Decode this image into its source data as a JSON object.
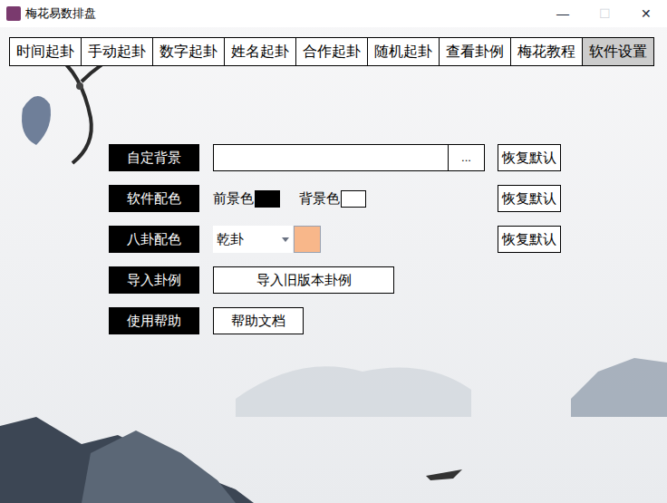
{
  "window": {
    "title": "梅花易数排盘",
    "controls": [
      "—",
      "☐",
      "✕"
    ]
  },
  "tabs": [
    {
      "label": "时间起卦",
      "selected": false
    },
    {
      "label": "手动起卦",
      "selected": false
    },
    {
      "label": "数字起卦",
      "selected": false
    },
    {
      "label": "姓名起卦",
      "selected": false
    },
    {
      "label": "合作起卦",
      "selected": false
    },
    {
      "label": "随机起卦",
      "selected": false
    },
    {
      "label": "查看卦例",
      "selected": false
    },
    {
      "label": "梅花教程",
      "selected": false
    },
    {
      "label": "软件设置",
      "selected": true
    }
  ],
  "settings": [
    {
      "kind": "path",
      "label": "自定背景",
      "value": "",
      "browse": "...",
      "reset": "恢复默认"
    },
    {
      "kind": "colors",
      "label": "软件配色",
      "swatches": [
        {
          "label": "前景色",
          "color": "#000000"
        },
        {
          "label": "背景色",
          "color": "#ffffff"
        }
      ],
      "reset": "恢复默认"
    },
    {
      "kind": "trigram",
      "label": "八卦配色",
      "value": "乾卦",
      "color": "#f8b78a",
      "reset": "恢复默认"
    },
    {
      "kind": "button",
      "label": "导入卦例",
      "button": "导入旧版本卦例"
    },
    {
      "kind": "button",
      "label": "使用帮助",
      "button": "帮助文档"
    }
  ]
}
